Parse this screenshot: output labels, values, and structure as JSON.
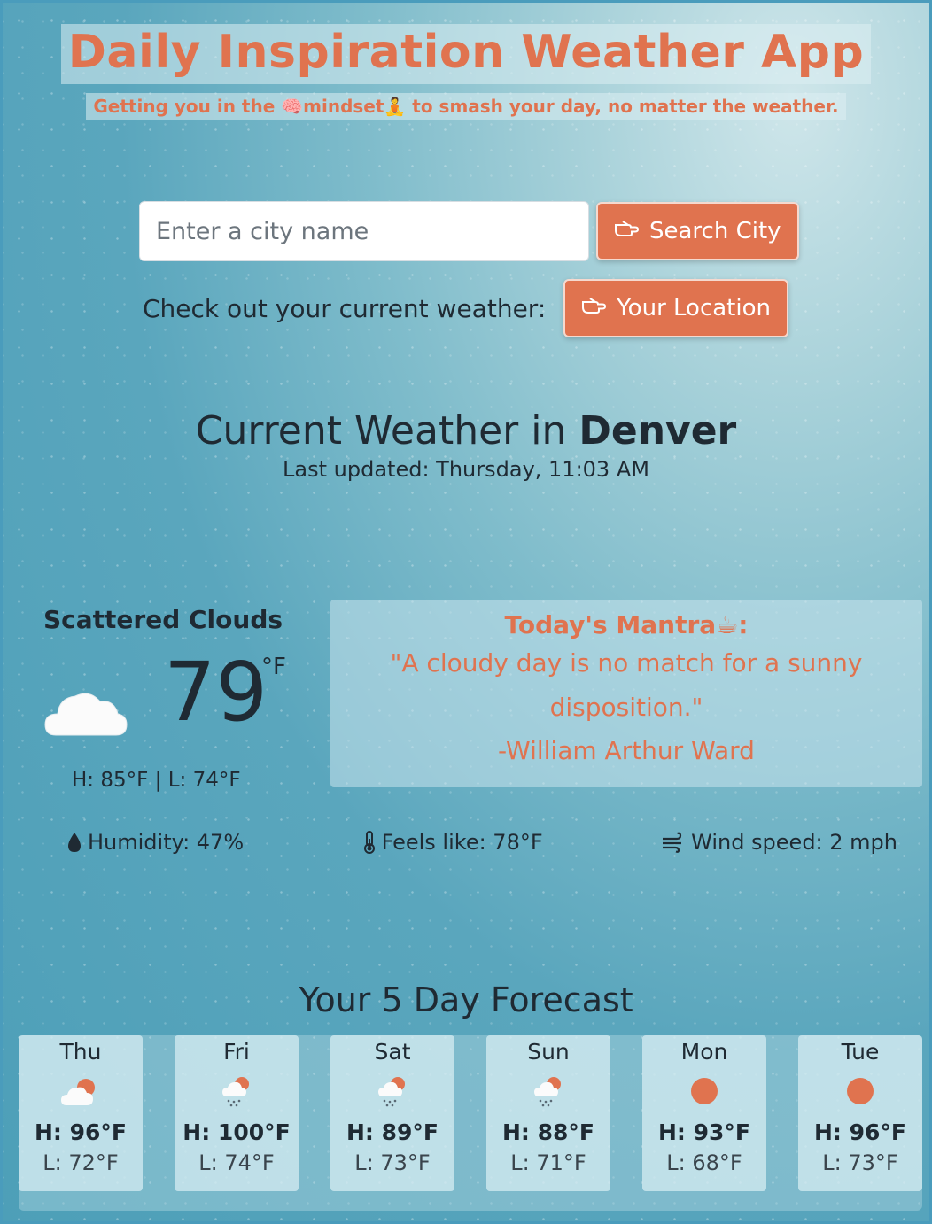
{
  "app": {
    "title": "Daily Inspiration Weather App",
    "subtitle": "Getting you in the 🧠mindset🧘 to smash your day, no matter the weather."
  },
  "search": {
    "placeholder": "Enter a city name",
    "value": "",
    "button_icon": "👉-hand-icon",
    "button_label": "Search City"
  },
  "location": {
    "prompt": "Check out your current weather:",
    "button_label": "Your Location"
  },
  "current": {
    "title_prefix": "Current Weather in",
    "city": "Denver",
    "last_updated": "Last updated: Thursday, 11:03 AM",
    "condition": "Scattered Clouds",
    "icon": "cloud-icon",
    "temp": "79",
    "unit": "°F",
    "hilo": "H: 85°F | L: 74°F",
    "humidity": "Humidity: 47%",
    "feels_like": "Feels like: 78°F",
    "wind": "Wind speed: 2 mph"
  },
  "mantra": {
    "heading": "Today's Mantra☕:",
    "quote": "\"A cloudy day is no match for a sunny disposition.\"",
    "author": "-William Arthur Ward"
  },
  "forecast": {
    "title": "Your 5 Day Forecast",
    "days": [
      {
        "day": "Thu",
        "icon": "sun-behind-cloud-icon",
        "hi": "H: 96°F",
        "lo": "L: 72°F"
      },
      {
        "day": "Fri",
        "icon": "sun-cloud-rain-icon",
        "hi": "H: 100°F",
        "lo": "L: 74°F"
      },
      {
        "day": "Sat",
        "icon": "sun-cloud-rain-icon",
        "hi": "H: 89°F",
        "lo": "L: 73°F"
      },
      {
        "day": "Sun",
        "icon": "sun-cloud-rain-icon",
        "hi": "H: 88°F",
        "lo": "L: 71°F"
      },
      {
        "day": "Mon",
        "icon": "sun-icon",
        "hi": "H: 93°F",
        "lo": "L: 68°F"
      },
      {
        "day": "Tue",
        "icon": "sun-icon",
        "hi": "H: 96°F",
        "lo": "L: 73°F"
      }
    ]
  },
  "colors": {
    "accent": "#e0734f",
    "text": "#1f2a33"
  }
}
